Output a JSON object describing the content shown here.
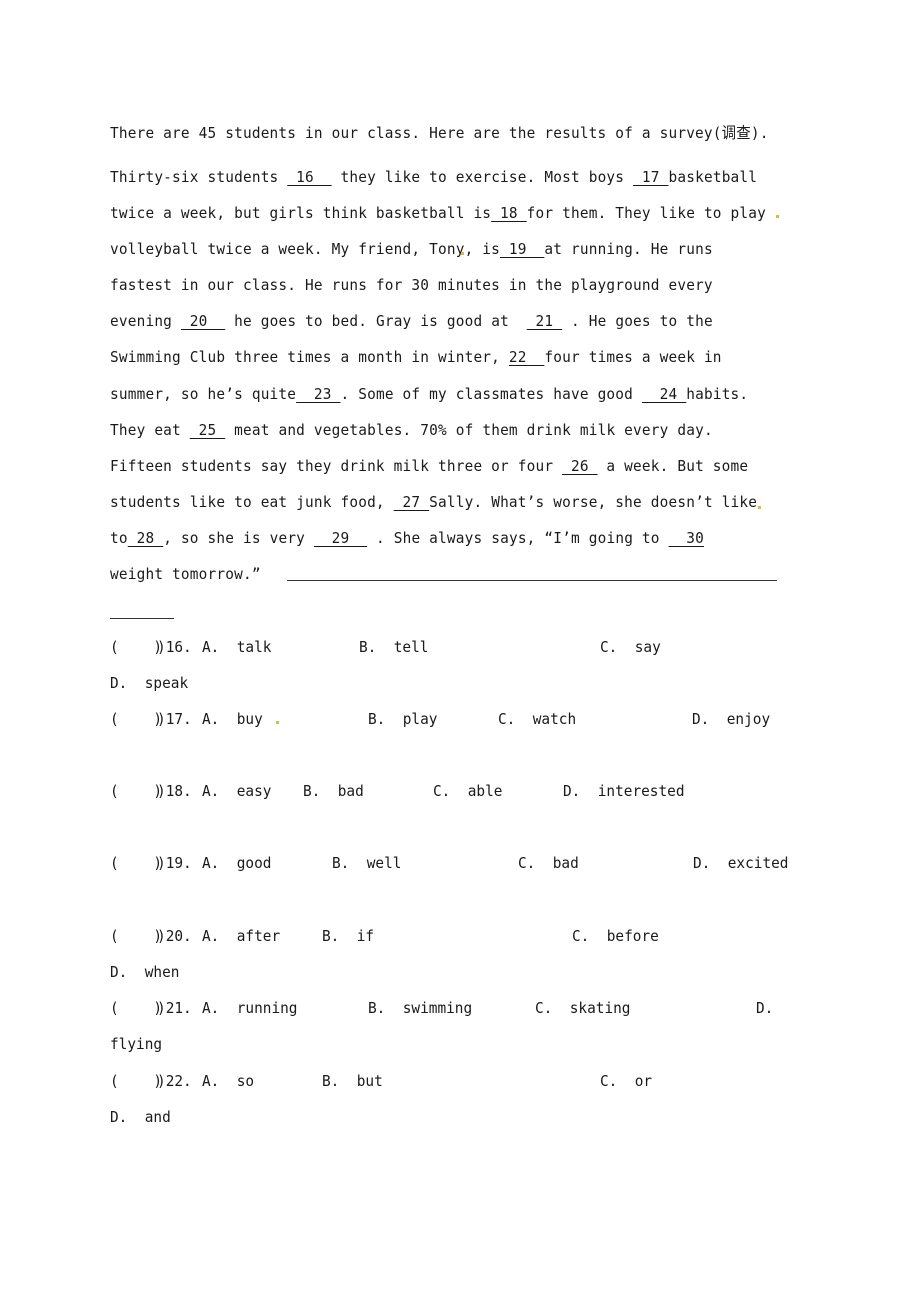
{
  "passage": {
    "lines": [
      [
        {
          "t": "There are 45 students in our class. Here are the results of a survey(调查)."
        }
      ],
      [
        {
          "t": "Thirty-six students "
        },
        {
          "b": " 16  "
        },
        {
          "t": " they like to exercise. Most boys "
        },
        {
          "b": " 17 "
        },
        {
          "t": "basketball"
        }
      ],
      [
        {
          "t": "twice a week, but girls think basketball is"
        },
        {
          "b": " 18 "
        },
        {
          "t": "for them. They like to play"
        }
      ],
      [
        {
          "t": "volleyball twice a week. My friend, Tony, is"
        },
        {
          "b": " 19  "
        },
        {
          "t": "at running. He runs"
        }
      ],
      [
        {
          "t": "fastest in our class. He runs for 30 minutes in the playground every"
        }
      ],
      [
        {
          "t": "evening "
        },
        {
          "b": " 20  "
        },
        {
          "t": " he goes to bed. Gray is good at  "
        },
        {
          "b": " 21 "
        },
        {
          "t": " . He goes to the"
        }
      ],
      [
        {
          "t": "Swimming Club three times a month in winter, "
        },
        {
          "b": "22  "
        },
        {
          "t": "four times a week in"
        }
      ],
      [
        {
          "t": "summer, so he’s quite"
        },
        {
          "b": "  23 "
        },
        {
          "t": ". Some of my classmates have good "
        },
        {
          "b": "  24 "
        },
        {
          "t": "habits."
        }
      ],
      [
        {
          "t": "They eat "
        },
        {
          "b": " 25 "
        },
        {
          "t": " meat and vegetables. 70% of them drink milk every day."
        }
      ],
      [
        {
          "t": "Fifteen students say they drink milk three or four "
        },
        {
          "b": " 26 "
        },
        {
          "t": " a week. But some"
        }
      ],
      [
        {
          "t": "students like to eat junk food, "
        },
        {
          "b": " 27 "
        },
        {
          "t": "Sally. What’s worse, she doesn’t like"
        }
      ],
      [
        {
          "t": "to"
        },
        {
          "b": " 28 "
        },
        {
          "t": ", so she is very "
        },
        {
          "b": "  29  "
        },
        {
          "t": " . She always says, “I’m going to "
        },
        {
          "b": "  30"
        }
      ],
      [
        {
          "t": "weight tomorrow.”"
        }
      ]
    ]
  },
  "questions": [
    {
      "number": "16",
      "bracket": "(    )",
      "options": {
        "A": "talk",
        "B": "tell",
        "C": "say",
        "D": "speak"
      }
    },
    {
      "number": "17",
      "bracket": "(    )",
      "options": {
        "A": "buy",
        "B": "play",
        "C": "watch",
        "D": "enjoy"
      }
    },
    {
      "number": "18",
      "bracket": "(    )",
      "options": {
        "A": "easy",
        "B": "bad",
        "C": "able",
        "D": "interested"
      }
    },
    {
      "number": "19",
      "bracket": "(    )",
      "options": {
        "A": "good",
        "B": "well",
        "C": "bad",
        "D": "excited"
      }
    },
    {
      "number": "20",
      "bracket": "(    )",
      "options": {
        "A": "after",
        "B": "if",
        "C": "before",
        "D": "when"
      }
    },
    {
      "number": "21",
      "bracket": "(    )",
      "options": {
        "A": "running",
        "B": "swimming",
        "C": "skating",
        "D": "flying"
      }
    },
    {
      "number": "22",
      "bracket": "(    )",
      "options": {
        "A": "so",
        "B": "but",
        "C": "or",
        "D": "and"
      }
    }
  ],
  "labels": {
    "A": "A.",
    "B": "B.",
    "C": "C.",
    "D": "D."
  }
}
